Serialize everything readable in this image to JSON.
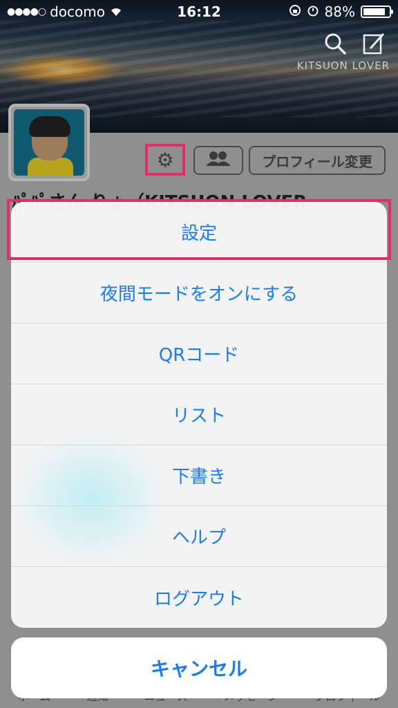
{
  "status_bar": {
    "signal": "●●●●○",
    "carrier": "docomo",
    "time": "16:12",
    "battery_text": "88%",
    "battery_level": 0.88
  },
  "banner": {
    "title": "KITSUON LOVER"
  },
  "profile": {
    "edit_button": "プロフィール変更",
    "name_peek": "ﾊﾟﾊﾟさん りょ（KITSUON LOVER"
  },
  "action_sheet": {
    "items": [
      {
        "label": "設定"
      },
      {
        "label": "夜間モードをオンにする"
      },
      {
        "label": "QRコード"
      },
      {
        "label": "リスト"
      },
      {
        "label": "下書き"
      },
      {
        "label": "ヘルプ"
      },
      {
        "label": "ログアウト"
      }
    ],
    "cancel": "キャンセル"
  },
  "bottom_tabs": [
    "ホーム",
    "通知",
    "ニュース",
    "メッセージ",
    "プロフィール"
  ],
  "colors": {
    "accent": "#1a7cf5",
    "highlight": "#e32c6a"
  }
}
